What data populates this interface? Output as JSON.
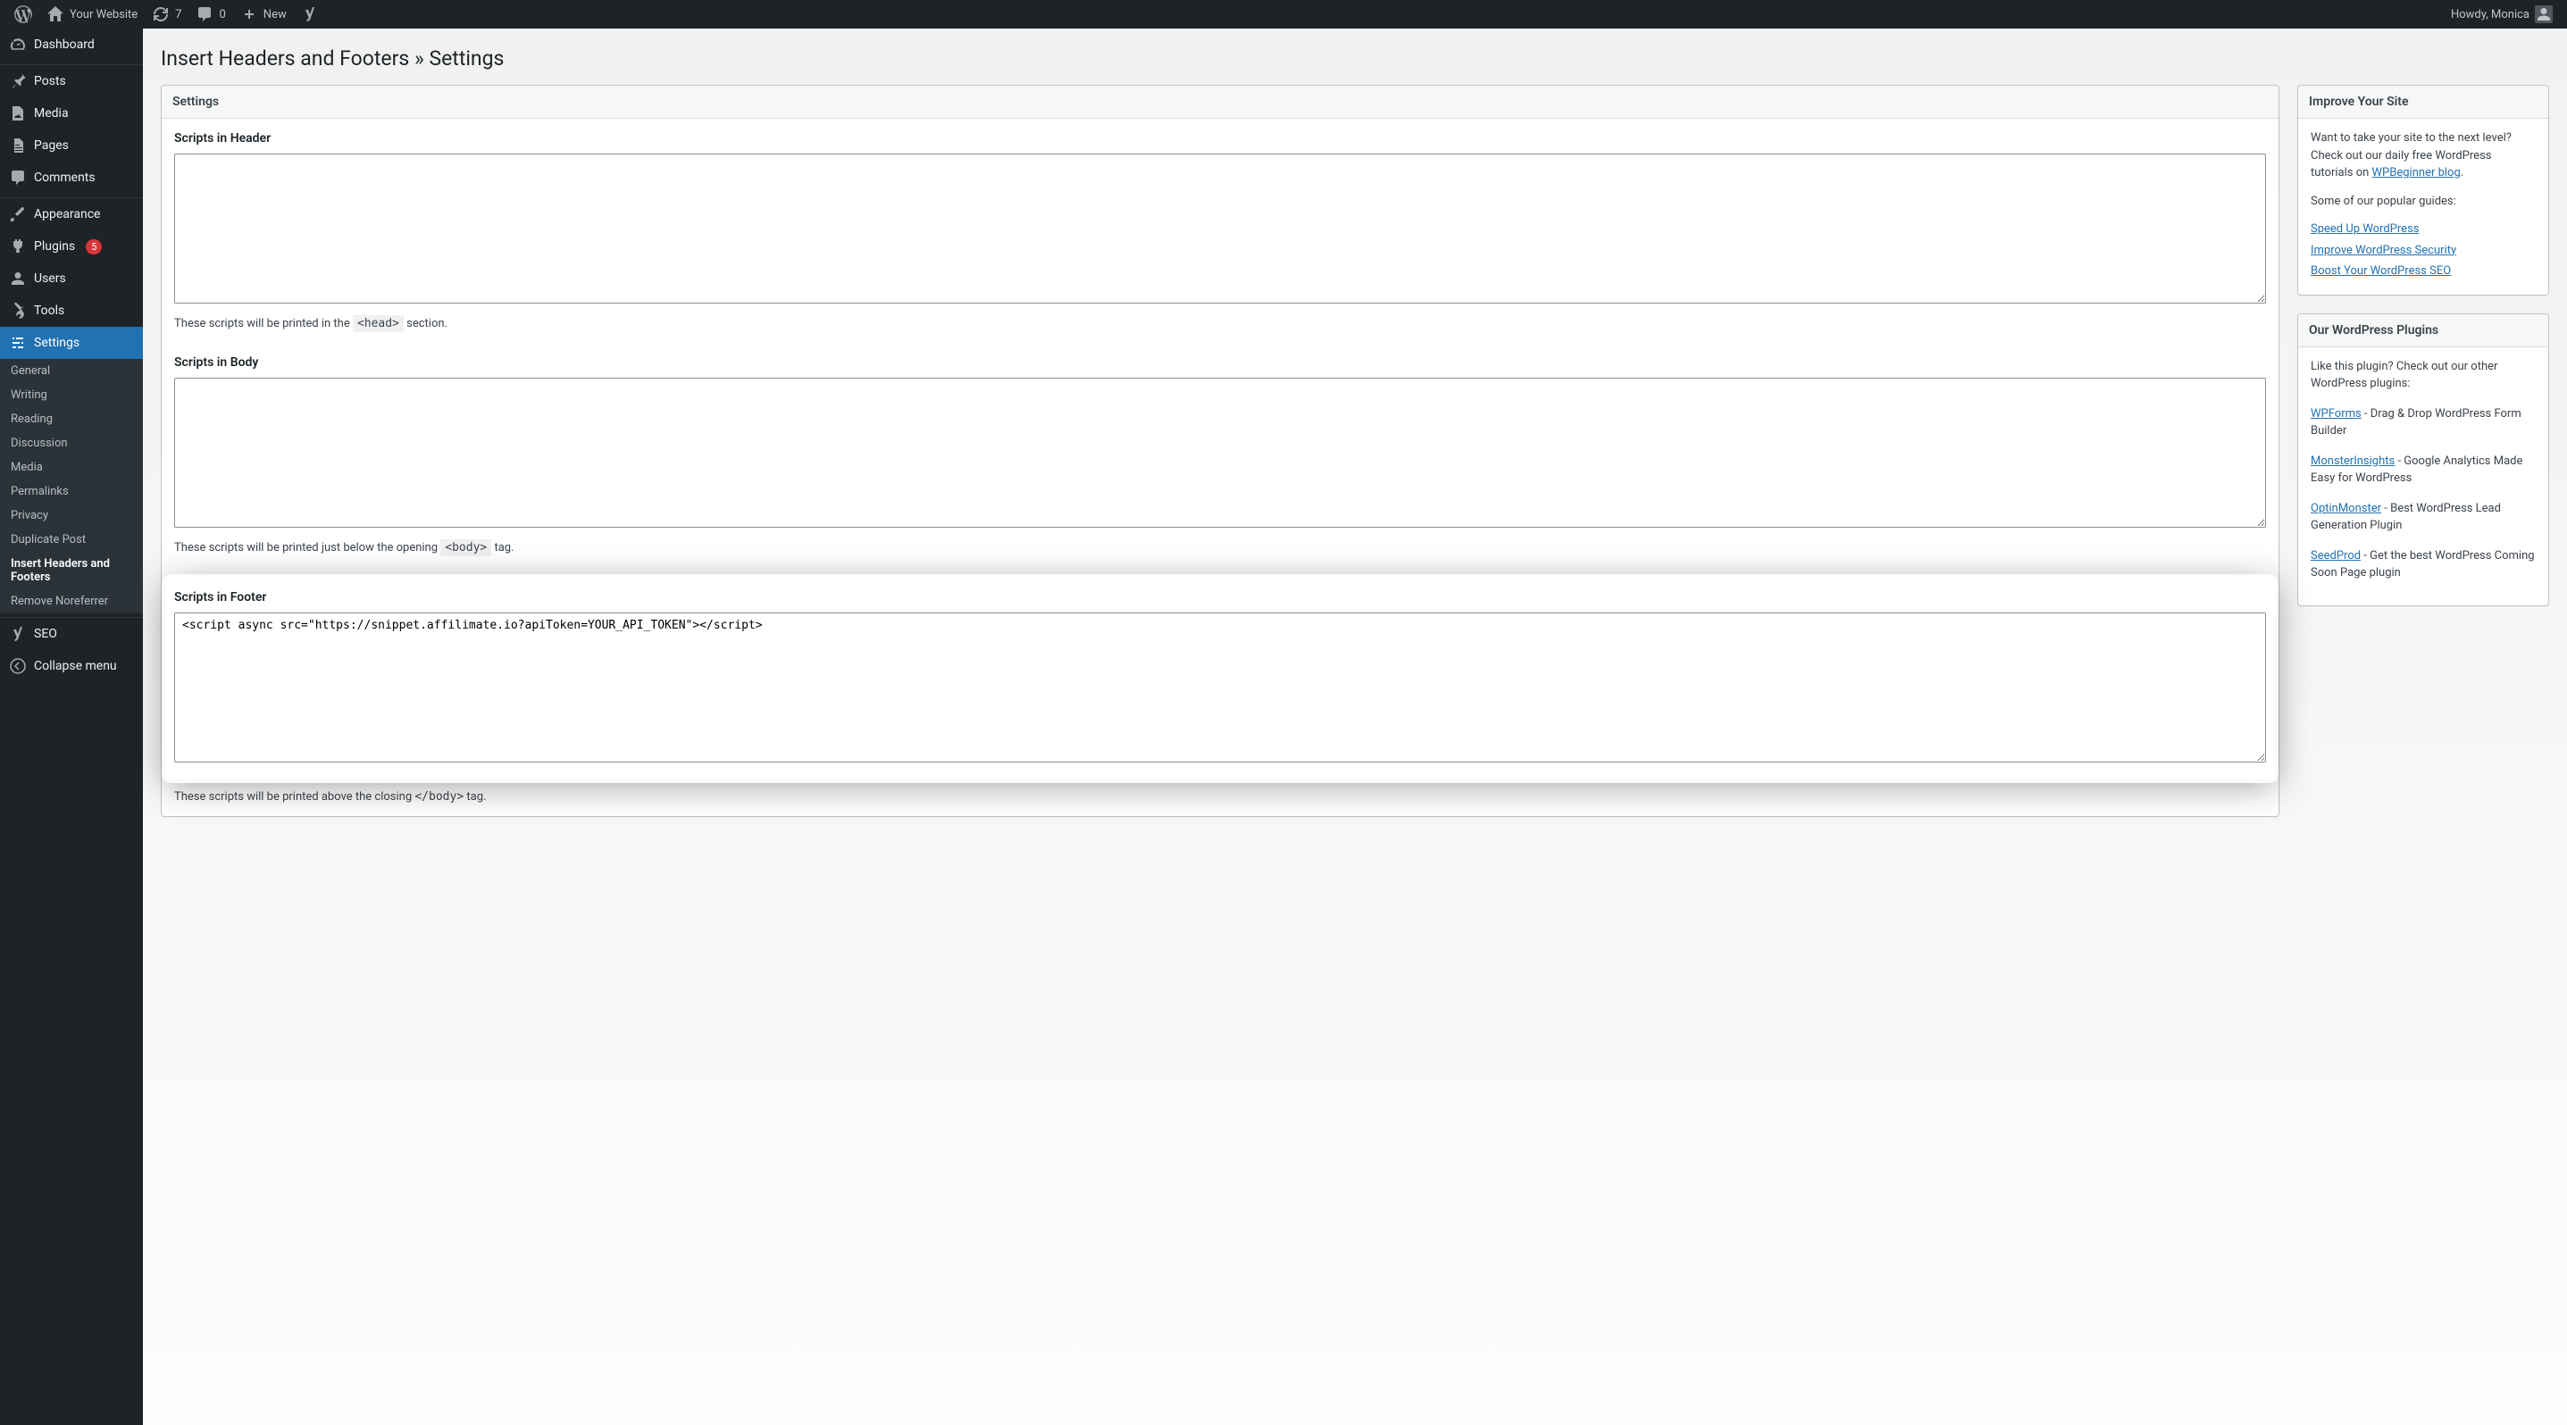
{
  "adminbar": {
    "site_name": "Your Website",
    "updates": "7",
    "comments": "0",
    "new_label": "New",
    "howdy": "Howdy, Monica"
  },
  "adminmenu": {
    "dashboard": "Dashboard",
    "posts": "Posts",
    "media": "Media",
    "pages": "Pages",
    "comments": "Comments",
    "appearance": "Appearance",
    "plugins": "Plugins",
    "plugins_count": "5",
    "users": "Users",
    "tools": "Tools",
    "settings": "Settings",
    "seo": "SEO",
    "collapse": "Collapse menu",
    "sub": {
      "general": "General",
      "writing": "Writing",
      "reading": "Reading",
      "discussion": "Discussion",
      "media": "Media",
      "permalinks": "Permalinks",
      "privacy": "Privacy",
      "duplicate_post": "Duplicate Post",
      "ihaf": "Insert Headers and Footers",
      "remove_noreferrer": "Remove Noreferrer"
    }
  },
  "page": {
    "title": "Insert Headers and Footers » Settings"
  },
  "settings_box": {
    "title": "Settings",
    "header": {
      "label": "Scripts in Header",
      "value": "",
      "help_pre": "These scripts will be printed in the ",
      "help_code": "<head>",
      "help_post": " section."
    },
    "body": {
      "label": "Scripts in Body",
      "value": "",
      "help_pre": "These scripts will be printed just below the opening ",
      "help_code": "<body>",
      "help_post": " tag."
    },
    "footer": {
      "label": "Scripts in Footer",
      "value": "<script async src=\"https://snippet.affilimate.io?apiToken=YOUR_API_TOKEN\"></script>",
      "help_pre": "These scripts will be printed above the closing ",
      "help_code": "</body>",
      "help_post": " tag."
    }
  },
  "improve": {
    "title": "Improve Your Site",
    "para1": "Want to take your site to the next level? Check out our daily free WordPress tutorials on ",
    "link1": "WPBeginner blog",
    "para1_end": ".",
    "para2": "Some of our popular guides:",
    "guides": {
      "0": "Speed Up WordPress",
      "1": "Improve WordPress Security",
      "2": "Boost Your WordPress SEO"
    }
  },
  "plugins_box": {
    "title": "Our WordPress Plugins",
    "intro": "Like this plugin? Check out our other WordPress plugins:",
    "items": {
      "0": {
        "name": "WPForms",
        "desc": " - Drag & Drop WordPress Form Builder"
      },
      "1": {
        "name": "MonsterInsights",
        "desc": " - Google Analytics Made Easy for WordPress"
      },
      "2": {
        "name": "OptinMonster",
        "desc": " - Best WordPress Lead Generation Plugin"
      },
      "3": {
        "name": "SeedProd",
        "desc": " - Get the best WordPress Coming Soon Page plugin"
      }
    }
  }
}
